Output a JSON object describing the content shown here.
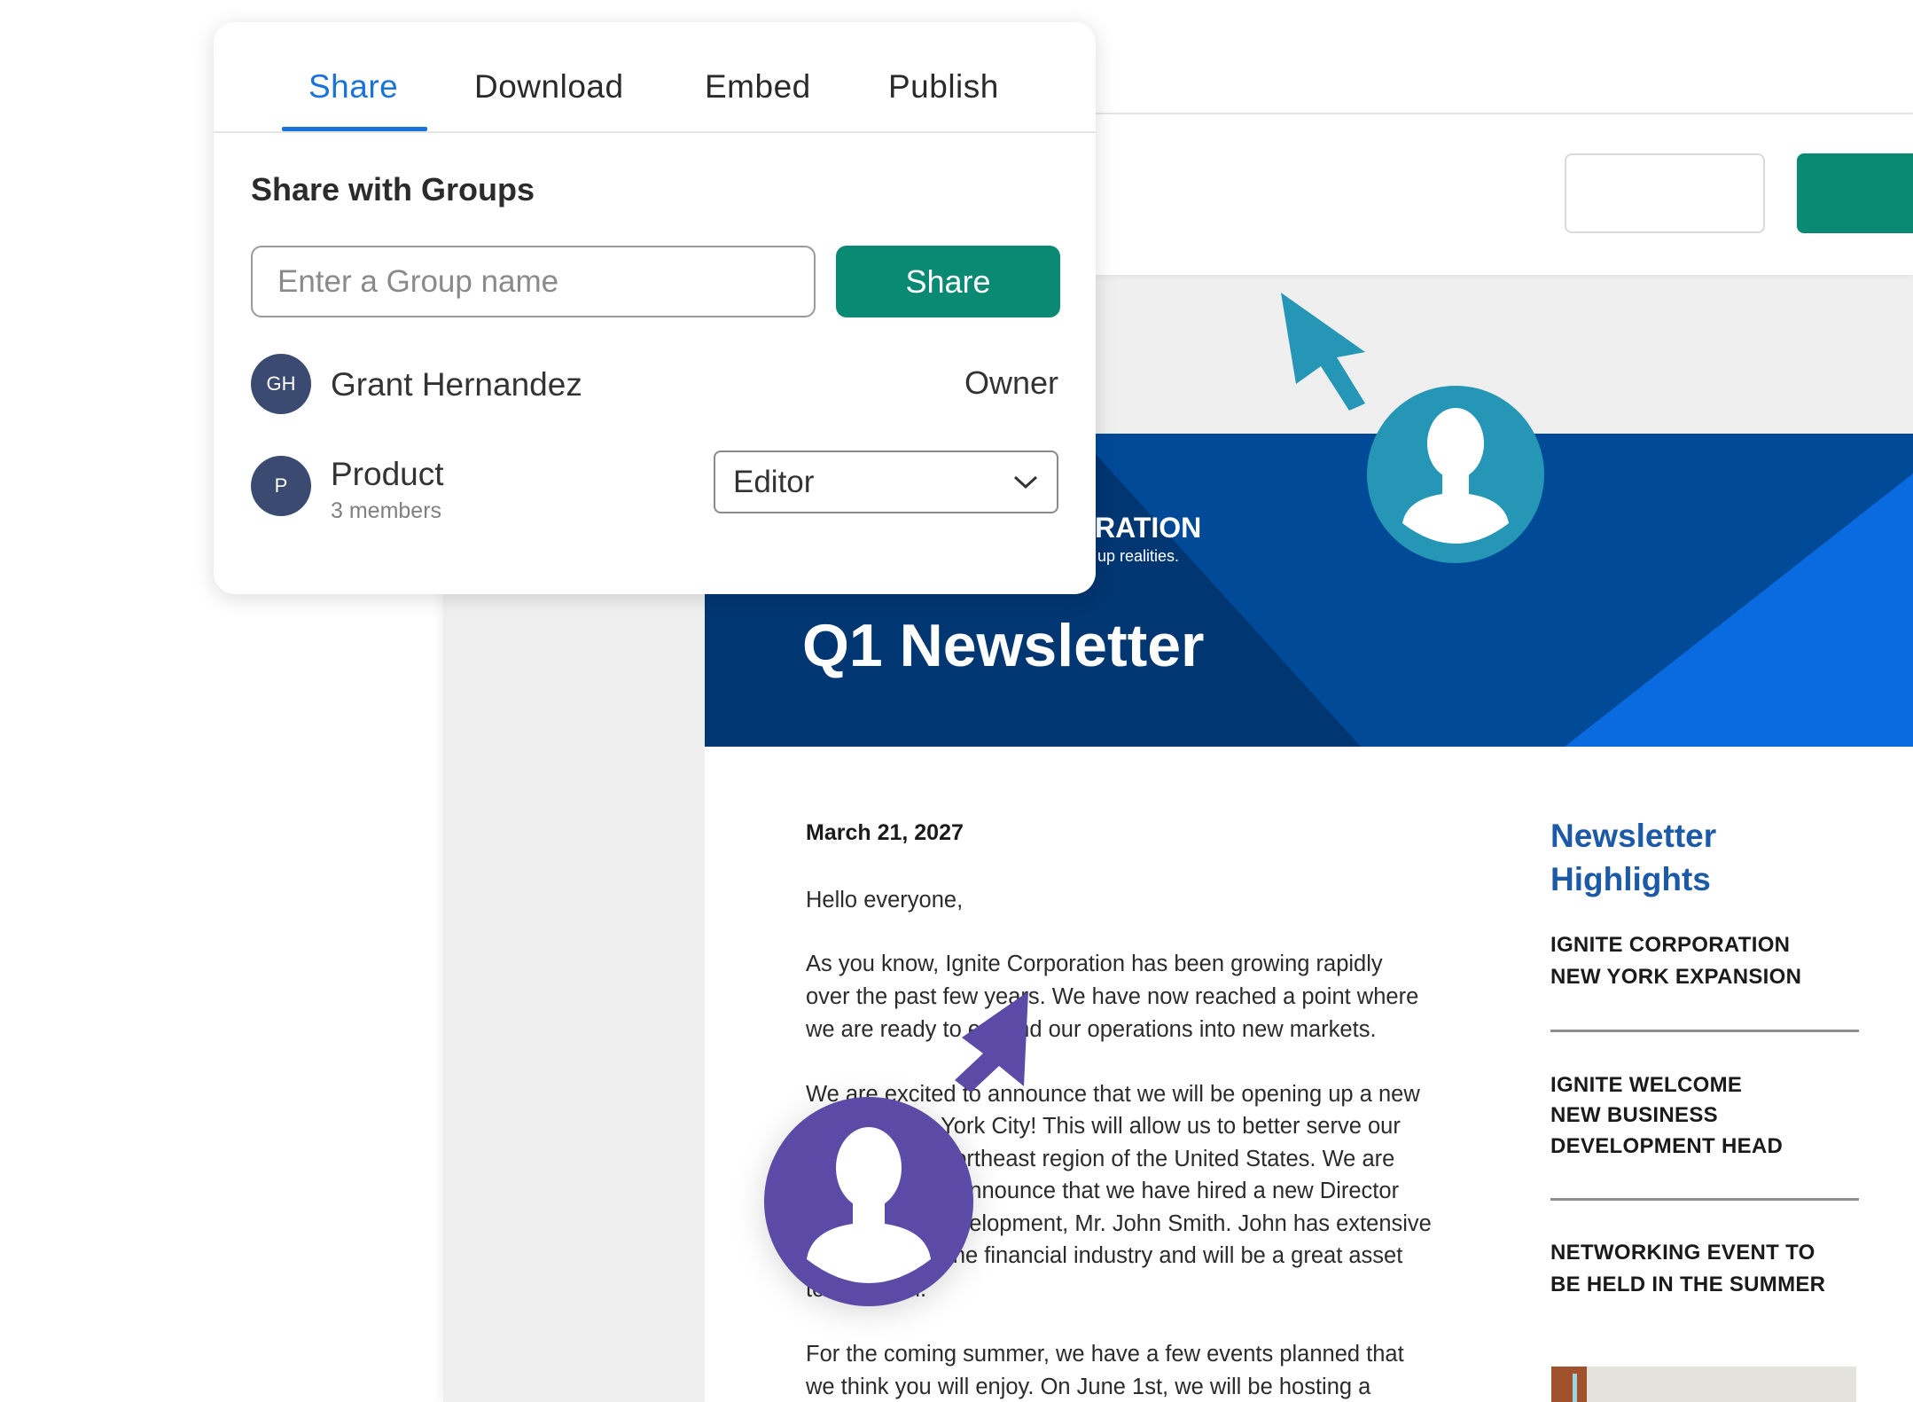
{
  "share_panel": {
    "tabs": [
      {
        "label": "Share",
        "active": true
      },
      {
        "label": "Download",
        "active": false
      },
      {
        "label": "Embed",
        "active": false
      },
      {
        "label": "Publish",
        "active": false
      }
    ],
    "section_title": "Share with Groups",
    "group_input": {
      "placeholder": "Enter a Group name",
      "value": ""
    },
    "share_button": "Share",
    "members": [
      {
        "initials": "GH",
        "name": "Grant Hernandez",
        "role": "Owner"
      },
      {
        "initials": "P",
        "name": "Product",
        "subtitle": "3 members",
        "role": "Editor"
      }
    ]
  },
  "newsletter": {
    "company_fragment": "RATION",
    "tagline_fragment": "up realities.",
    "title": "Q1 Newsletter",
    "date": "March 21, 2027",
    "greeting": "Hello everyone,",
    "paragraph1": [
      "As you know, Ignite Corporation has been growing rapidly",
      "over the past few years. We have now reached a point where",
      "we are ready to expand our operations into new markets."
    ],
    "paragraph2": [
      "We are excited to announce that we will be opening up a new",
      "office in New York City! This will allow us to better serve our",
      "clients in the Northeast region of the United States. We are",
      "also excited to announce that we have hired a new Director",
      "of Business Development, Mr. John Smith. John has extensive",
      "experience in the financial industry and will be a great asset",
      "to our team."
    ],
    "paragraph3": [
      "For the coming summer, we have a few events planned that",
      "we think you will enjoy. On June 1st, we will be hosting a"
    ],
    "highlights_title": [
      "Newsletter",
      "Highlights"
    ],
    "highlights": [
      [
        "IGNITE CORPORATION",
        "NEW YORK EXPANSION"
      ],
      [
        "IGNITE WELCOME",
        "NEW BUSINESS",
        "DEVELOPMENT HEAD"
      ],
      [
        "NETWORKING EVENT TO",
        "BE HELD IN THE SUMMER"
      ]
    ]
  },
  "colors": {
    "accent": "#1a73d9",
    "primary_button": "#0b8a73",
    "banner": "#003672",
    "cursor_teal": "#2596b5",
    "cursor_purple": "#5b4aa6",
    "highlight_title": "#1c5aa8"
  },
  "icons": [
    "chevron-down-icon",
    "cursor-arrow-icon",
    "user-avatar-icon"
  ]
}
